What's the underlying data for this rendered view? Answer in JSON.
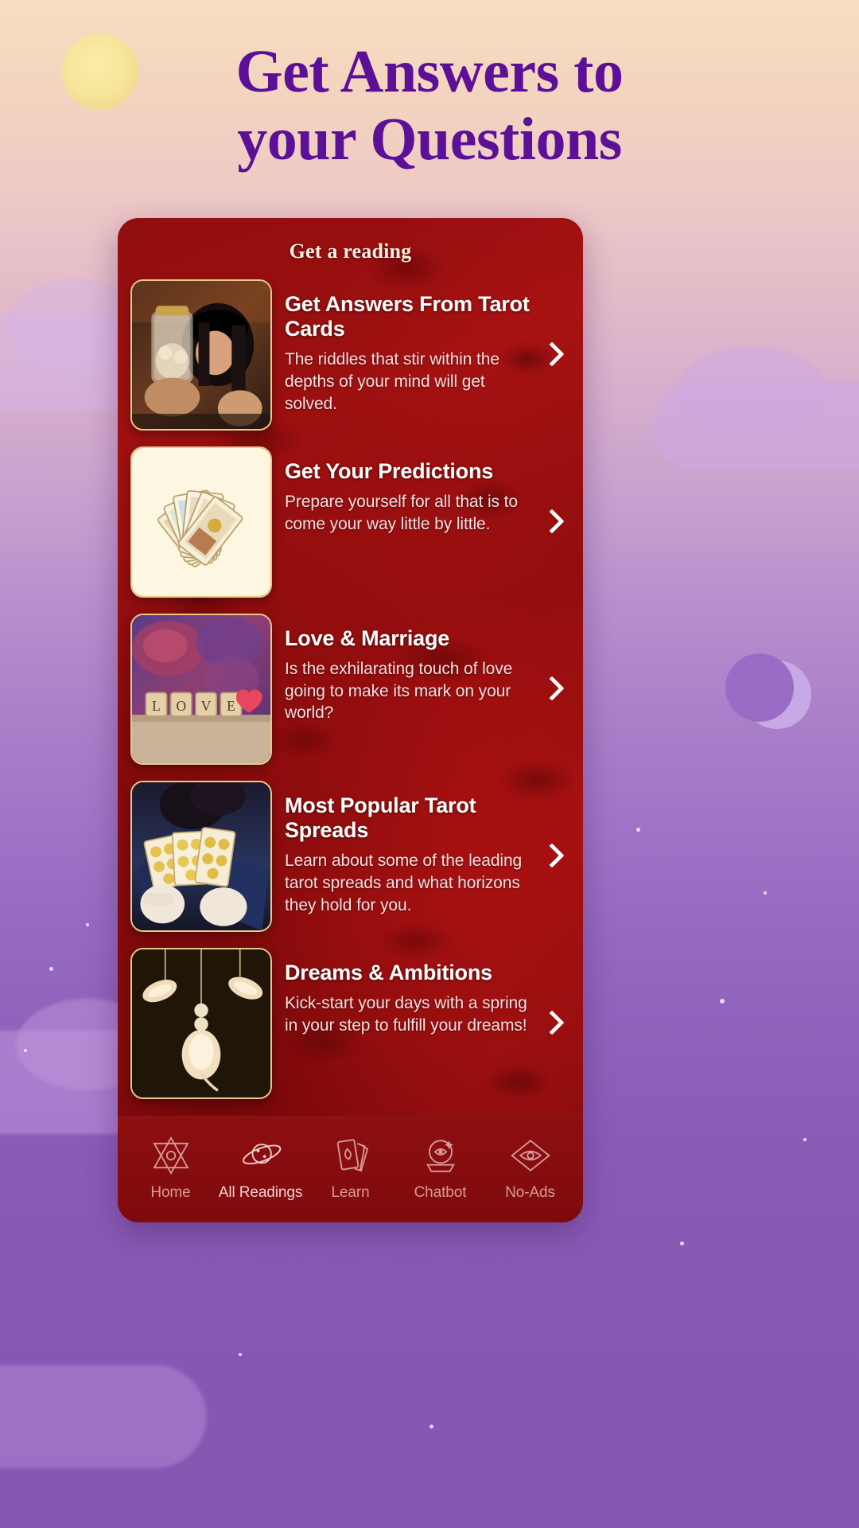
{
  "headline": {
    "line1": "Get Answers to",
    "line2": "your Questions",
    "color": "#5c1097"
  },
  "decor": {
    "sun": "sun-icon",
    "moon": "crescent-moon-icon",
    "clouds": "cloud-shape"
  },
  "app": {
    "card_title": "Get a reading",
    "background_color": "#a11212",
    "items": [
      {
        "title": "Get Answers From Tarot Cards",
        "desc": "The riddles that stir within the depths of your mind will get solved.",
        "thumb": "woman-with-jar-photo",
        "chevron": "chevron-right-icon"
      },
      {
        "title": "Get Your Predictions",
        "desc": "Prepare yourself for all that is to come your way little by little.",
        "thumb": "tarot-card-fan-photo",
        "chevron": "chevron-right-icon"
      },
      {
        "title": "Love & Marriage",
        "desc": "Is the exhilarating touch of love going to make its mark on your world?",
        "thumb": "love-scrabble-tiles-photo",
        "chevron": "chevron-right-icon"
      },
      {
        "title": "Most Popular Tarot Spreads",
        "desc": "Learn about some of the leading tarot spreads and what horizons they hold for you.",
        "thumb": "woman-holding-tarot-cards-photo",
        "chevron": "chevron-right-icon"
      },
      {
        "title": "Dreams & Ambitions",
        "desc": "Kick-start your days with a spring in your step to fulfill your dreams!",
        "thumb": "hanging-feathers-photo",
        "chevron": "chevron-right-icon"
      }
    ],
    "nav": {
      "active_index": 1,
      "items": [
        {
          "label": "Home",
          "icon": "hexagram-star-icon"
        },
        {
          "label": "All Readings",
          "icon": "saturn-planet-icon"
        },
        {
          "label": "Learn",
          "icon": "tarot-cards-icon"
        },
        {
          "label": "Chatbot",
          "icon": "crystal-ball-icon"
        },
        {
          "label": "No-Ads",
          "icon": "no-ads-eye-icon"
        }
      ]
    }
  }
}
